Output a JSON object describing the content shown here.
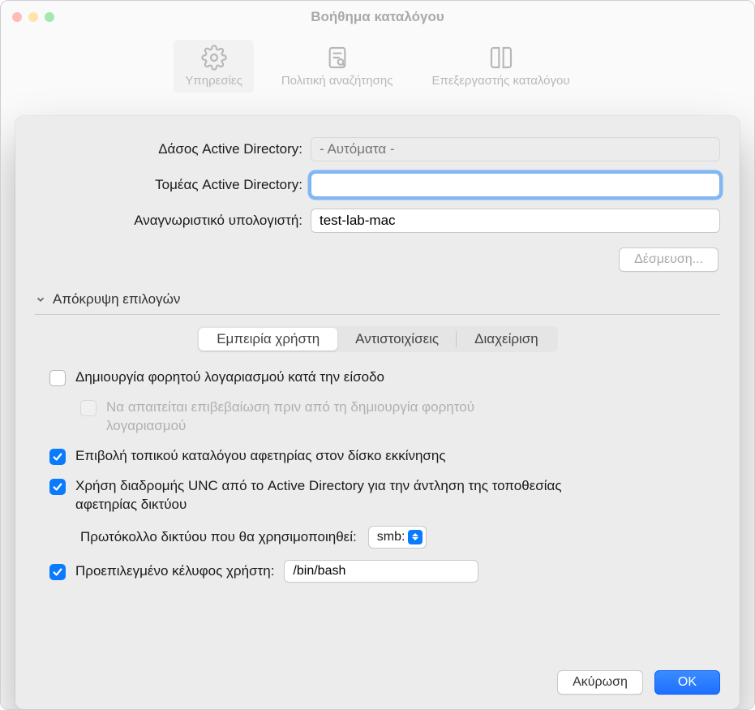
{
  "window": {
    "title": "Βοήθημα καταλόγου"
  },
  "toolbar": {
    "items": [
      {
        "name": "services",
        "label": "Υπηρεσίες"
      },
      {
        "name": "search-policy",
        "label": "Πολιτική αναζήτησης"
      },
      {
        "name": "directory-editor",
        "label": "Επεξεργαστής καταλόγου"
      }
    ]
  },
  "form": {
    "forest_label": "Δάσος Active Directory:",
    "forest_placeholder": "- Αυτόματα -",
    "domain_label": "Τομέας Active Directory:",
    "domain_value": "",
    "computer_id_label": "Αναγνωριστικό υπολογιστή:",
    "computer_id_value": "test-lab-mac",
    "bind_button": "Δέσμευση..."
  },
  "disclosure": {
    "label": "Απόκρυψη επιλογών"
  },
  "tabs": {
    "items": [
      {
        "name": "user-experience",
        "label": "Εμπειρία χρήστη",
        "active": true
      },
      {
        "name": "mappings",
        "label": "Αντιστοιχίσεις"
      },
      {
        "name": "administrative",
        "label": "Διαχείριση"
      }
    ]
  },
  "options": {
    "mobile_account": "Δημιουργία φορητού λογαριασμού κατά την είσοδο",
    "mobile_confirm": "Να απαιτείται επιβεβαίωση πριν από τη δημιουργία φορητού λογαριασμού",
    "force_local_home": "Επιβολή τοπικού καταλόγου αφετηρίας στον δίσκο εκκίνησης",
    "use_unc": "Χρήση διαδρομής UNC από το Active Directory για την άντληση της τοποθεσίας αφετηρίας δικτύου",
    "protocol_label": "Πρωτόκολλο δικτύου που θα χρησιμοποιηθεί:",
    "protocol_value": "smb:",
    "default_shell_label": "Προεπιλεγμένο κέλυφος χρήστη:",
    "default_shell_value": "/bin/bash"
  },
  "actions": {
    "cancel": "Ακύρωση",
    "ok": "OK"
  }
}
